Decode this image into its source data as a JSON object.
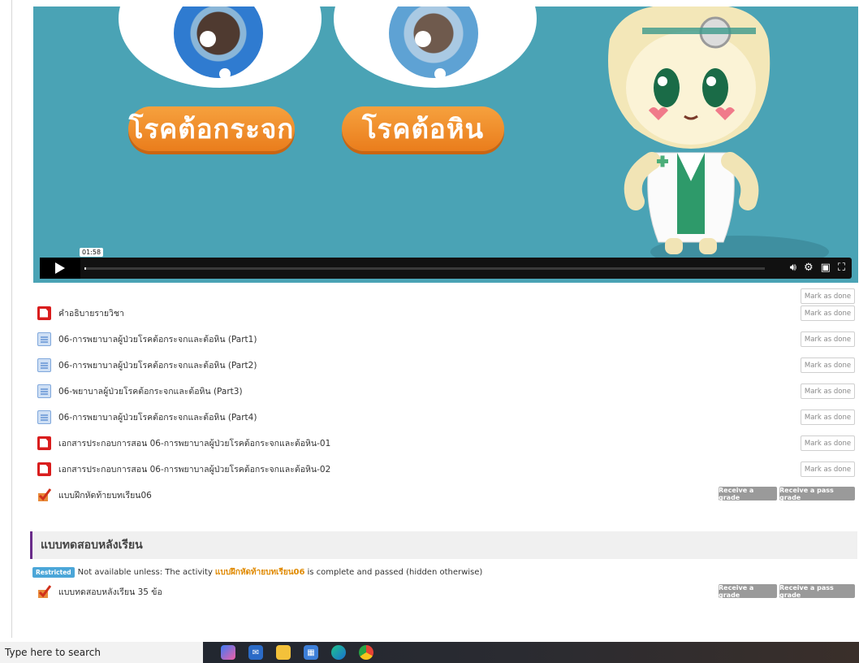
{
  "video": {
    "label_left": "โรคต้อกระจก",
    "label_right": "โรคต้อหิน",
    "time_tooltip": "01:58",
    "progress": 0.002,
    "icons": [
      "volume-icon",
      "settings-icon",
      "pip-icon",
      "fullscreen-icon"
    ]
  },
  "activities": {
    "mark_done_label": "Mark as done",
    "items": [
      {
        "name": "คำอธิบายรายวิชา",
        "icon": "pdf-icon"
      },
      {
        "name": "06-การพยาบาลผู้ป่วยโรคต้อกระจกและต้อหิน (Part1)",
        "icon": "page-icon"
      },
      {
        "name": "06-การพยาบาลผู้ป่วยโรคต้อกระจกและต้อหิน (Part2)",
        "icon": "page-icon"
      },
      {
        "name": "06-พยาบาลผู้ป่วยโรคต้อกระจกและต้อหิน (Part3)",
        "icon": "page-icon"
      },
      {
        "name": "06-การพยาบาลผู้ป่วยโรคต้อกระจกและต้อหิน (Part4)",
        "icon": "page-icon"
      },
      {
        "name": "เอกสารประกอบการสอน 06-การพยาบาลผู้ป่วยโรคต้อกระจกและต้อหิน-01",
        "icon": "pdf-icon"
      },
      {
        "name": "เอกสารประกอบการสอน 06-การพยาบาลผู้ป่วยโรคต้อกระจกและต้อหิน-02",
        "icon": "pdf-icon"
      },
      {
        "name": "แบบฝึกหัดท้ายบทเรียน06",
        "icon": "quiz-icon"
      }
    ],
    "receive_grade": "Receive a grade",
    "receive_pass_grade": "Receive a pass grade"
  },
  "section": {
    "title": "แบบทดสอบหลังเรียน",
    "restricted_badge": "Restricted",
    "restriction_prefix": "Not available unless: The activity",
    "restriction_link": "แบบฝึกหัดท้ายบทเรียน06",
    "restriction_suffix": "is complete and passed (hidden otherwise)",
    "quiz_name": "แบบทดสอบหลังเรียน 35 ข้อ"
  },
  "taskbar": {
    "search_placeholder": "Type here to search",
    "apps": [
      "copilot-icon",
      "mail-icon",
      "file-explorer-icon",
      "store-icon",
      "edge-icon",
      "chrome-icon"
    ]
  },
  "colors": {
    "video_bg": "#4aa3b5",
    "pill": "#ea7d1c",
    "section_accent": "#6a2c8a",
    "link": "#e08a00",
    "restricted": "#4ba6d8",
    "grade_button": "#9a9a9a"
  }
}
